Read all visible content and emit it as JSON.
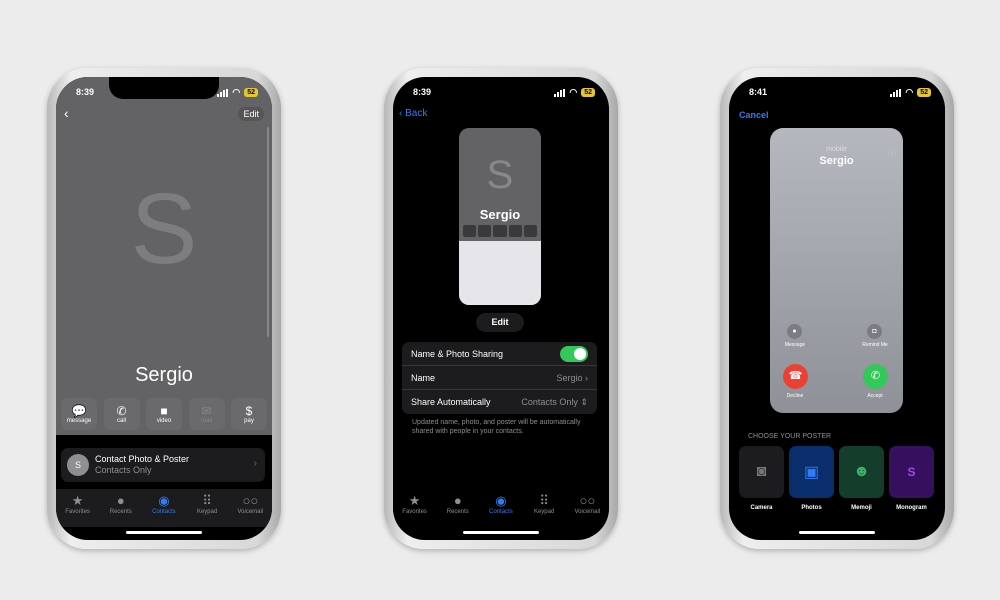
{
  "status": {
    "time1": "8:39",
    "time2": "8:39",
    "time3": "8:41",
    "battery": "52"
  },
  "tabbar": [
    {
      "label": "Favorites",
      "icon": "star-icon"
    },
    {
      "label": "Recents",
      "icon": "clock-icon"
    },
    {
      "label": "Contacts",
      "icon": "person-circle-icon"
    },
    {
      "label": "Keypad",
      "icon": "keypad-icon"
    },
    {
      "label": "Voicemail",
      "icon": "voicemail-icon"
    }
  ],
  "screen1": {
    "edit": "Edit",
    "monogram": "S",
    "name": "Sergio",
    "actions": [
      {
        "label": "message",
        "icon": "message-icon"
      },
      {
        "label": "call",
        "icon": "phone-icon"
      },
      {
        "label": "video",
        "icon": "video-icon"
      },
      {
        "label": "mail",
        "icon": "mail-icon",
        "disabled": true
      },
      {
        "label": "pay",
        "icon": "dollar-icon"
      }
    ],
    "card": {
      "avatar": "S",
      "title": "Contact Photo & Poster",
      "subtitle": "Contacts Only"
    }
  },
  "screen2": {
    "back": "Back",
    "monogram": "S",
    "name": "Sergio",
    "edit": "Edit",
    "rows": [
      {
        "label": "Name & Photo Sharing",
        "toggle": true
      },
      {
        "label": "Name",
        "value": "Sergio"
      },
      {
        "label": "Share Automatically",
        "value": "Contacts Only"
      }
    ],
    "footer": "Updated name, photo, and poster will be automatically shared with people in your contacts.",
    "toggle_color": "#34c759"
  },
  "screen3": {
    "cancel": "Cancel",
    "subtitle": "mobile",
    "name": "Sergio",
    "message": "Message",
    "remind": "Remind Me",
    "decline": "Decline",
    "accept": "Accept",
    "choose": "CHOOSE YOUR POSTER",
    "options": [
      {
        "label": "Camera",
        "icon": "camera-icon",
        "color": "#1c1c1e"
      },
      {
        "label": "Photos",
        "icon": "photos-icon",
        "color": "#0a2d6b"
      },
      {
        "label": "Memoji",
        "icon": "memoji-icon",
        "color": "#143d2b"
      },
      {
        "label": "Monogram",
        "icon": "S",
        "color": "#35105e"
      }
    ]
  }
}
